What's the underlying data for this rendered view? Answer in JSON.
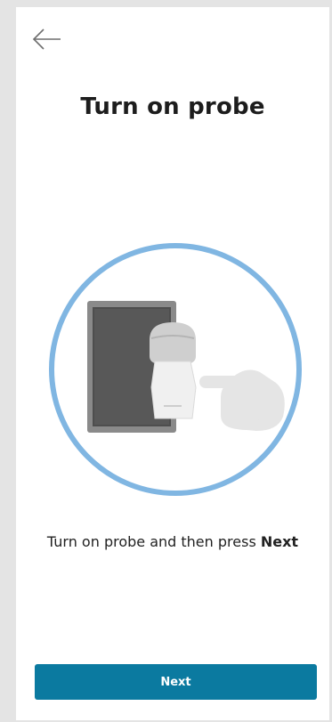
{
  "header": {
    "back_icon": "arrow-left-icon"
  },
  "page": {
    "title": "Turn on probe"
  },
  "illustration": {
    "icon": "probe-power-illustration",
    "ring_color": "#80b6e2",
    "tablet_color": "#555555",
    "probe_color": "#e8e8e8"
  },
  "instruction": {
    "text": "Turn on probe and then press ",
    "emphasis": "Next"
  },
  "footer": {
    "next_label": "Next",
    "button_color": "#0b7aa0"
  }
}
